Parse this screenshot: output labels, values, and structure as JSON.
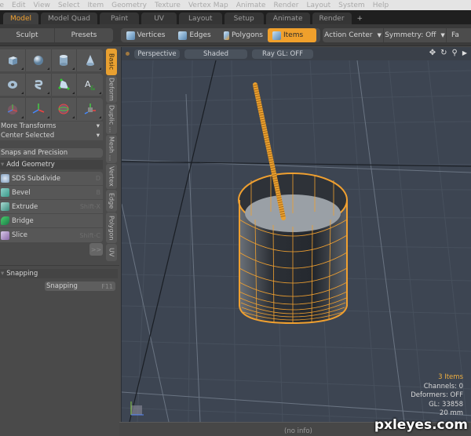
{
  "menubar": [
    "le",
    "Edit",
    "View",
    "Select",
    "Item",
    "Geometry",
    "Texture",
    "Vertex Map",
    "Animate",
    "Render",
    "Layout",
    "System",
    "Help"
  ],
  "tabs": [
    {
      "label": "Model",
      "active": true
    },
    {
      "label": "Model Quad",
      "active": false
    },
    {
      "label": "Paint",
      "active": false
    },
    {
      "label": "UV",
      "active": false
    },
    {
      "label": "Layout",
      "active": false
    },
    {
      "label": "Setup",
      "active": false
    },
    {
      "label": "Animate",
      "active": false
    },
    {
      "label": "Render",
      "active": false
    },
    {
      "label": "+",
      "active": false
    }
  ],
  "toolbar": {
    "sculpt": "Sculpt",
    "presets": "Presets",
    "vertices": "Vertices",
    "edges": "Edges",
    "polygons": "Polygons",
    "items": "Items",
    "action_center": "Action Center",
    "symmetry": "Symmetry: Off",
    "falloff": "Fa"
  },
  "left_panel": {
    "more_transforms": "More Transforms",
    "center_selected": "Center Selected",
    "snaps_precision": "Snaps and Precision",
    "add_geometry": "Add Geometry",
    "tools": [
      {
        "label": "SDS Subdivide",
        "key": "D",
        "icon": "sds-subdivide-icon"
      },
      {
        "label": "Bevel",
        "key": "B",
        "icon": "bevel-icon"
      },
      {
        "label": "Extrude",
        "key": "Shift-X",
        "icon": "extrude-icon"
      },
      {
        "label": "Bridge",
        "key": "",
        "icon": "bridge-icon"
      },
      {
        "label": "Slice",
        "key": "Shift-C",
        "icon": "slice-icon"
      }
    ],
    "more_button": ">>",
    "vertical_tabs": [
      "Basic",
      "Deform",
      "Duplic ...",
      "Mesh ...",
      "Vertex",
      "Edge",
      "Polygon",
      "UV"
    ],
    "snapping_header": "Snapping",
    "snapping_button": "Snapping",
    "snapping_key": "F11"
  },
  "viewport": {
    "projection": "Perspective",
    "shading": "Shaded",
    "raygl": "Ray GL: OFF",
    "icons": [
      "move-icon",
      "rotate-icon",
      "zoom-icon",
      "expand-icon"
    ],
    "info": {
      "items": "3 Items",
      "channels": "Channels: 0",
      "deformers": "Deformers: OFF",
      "gl": "GL: 33858",
      "unit": "20 mm"
    }
  },
  "statusbar": "(no info)",
  "watermark": "pxleyes.com",
  "colors": {
    "accent": "#f0a02c",
    "viewport_bg": "#3d4552",
    "wireframe": "#f0a030"
  }
}
